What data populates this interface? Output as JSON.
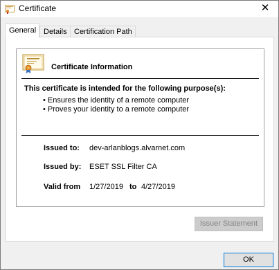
{
  "window": {
    "title": "Certificate",
    "close_glyph": "✕"
  },
  "tabs": [
    {
      "label": "General",
      "active": true
    },
    {
      "label": "Details",
      "active": false
    },
    {
      "label": "Certification Path",
      "active": false
    }
  ],
  "info": {
    "heading": "Certificate Information",
    "purpose_heading": "This certificate is intended for the following purpose(s):",
    "purposes": [
      "Ensures the identity of a remote computer",
      "Proves your identity to a remote computer"
    ],
    "issued_to_label": "Issued to:",
    "issued_to": "dev-arlanblogs.alvarnet.com",
    "issued_by_label": "Issued by:",
    "issued_by": "ESET SSL Filter CA",
    "valid_from_label": "Valid from",
    "valid_from": "1/27/2019",
    "to_label": "to",
    "valid_to": "4/27/2019"
  },
  "buttons": {
    "issuer_statement": "Issuer Statement",
    "ok": "OK"
  },
  "colors": {
    "accent": "#0078d7",
    "window_bg": "#f0f0f0"
  }
}
